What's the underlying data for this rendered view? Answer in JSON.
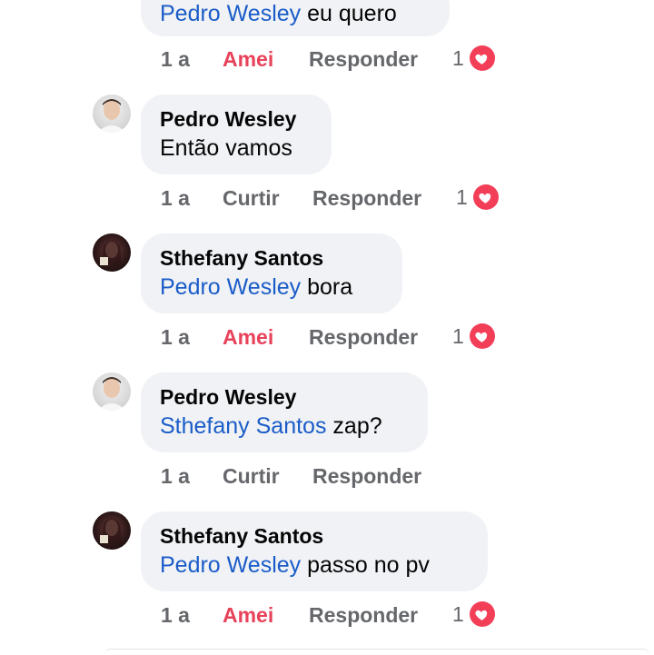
{
  "comments": [
    {
      "author": "",
      "mention": "Pedro Wesley",
      "text": " eu quero",
      "time": "1 a",
      "like_label": "Amei",
      "reply_label": "Responder",
      "reaction_count": "1",
      "reaction": "heart-icon"
    },
    {
      "author": "Pedro Wesley",
      "mention": "",
      "text": "Então vamos",
      "time": "1 a",
      "like_label": "Curtir",
      "reply_label": "Responder",
      "reaction_count": "1",
      "reaction": "heart-icon"
    },
    {
      "author": "Sthefany Santos",
      "mention": "Pedro Wesley",
      "text": " bora",
      "time": "1 a",
      "like_label": "Amei",
      "reply_label": "Responder",
      "reaction_count": "1",
      "reaction": "heart-icon"
    },
    {
      "author": "Pedro Wesley",
      "mention": "Sthefany Santos",
      "text": " zap?",
      "time": "1 a",
      "like_label": "Curtir",
      "reply_label": "Responder"
    },
    {
      "author": "Sthefany Santos",
      "mention": "Pedro Wesley",
      "text": " passo no pv",
      "time": "1 a",
      "like_label": "Amei",
      "reply_label": "Responder",
      "reaction_count": "1",
      "reaction": "heart-icon"
    }
  ],
  "colors": {
    "bubble": "#f0f2f5",
    "mention": "#1a5cc8",
    "amei": "#e8425a",
    "muted": "#65676b",
    "heart": "#f33e58"
  }
}
